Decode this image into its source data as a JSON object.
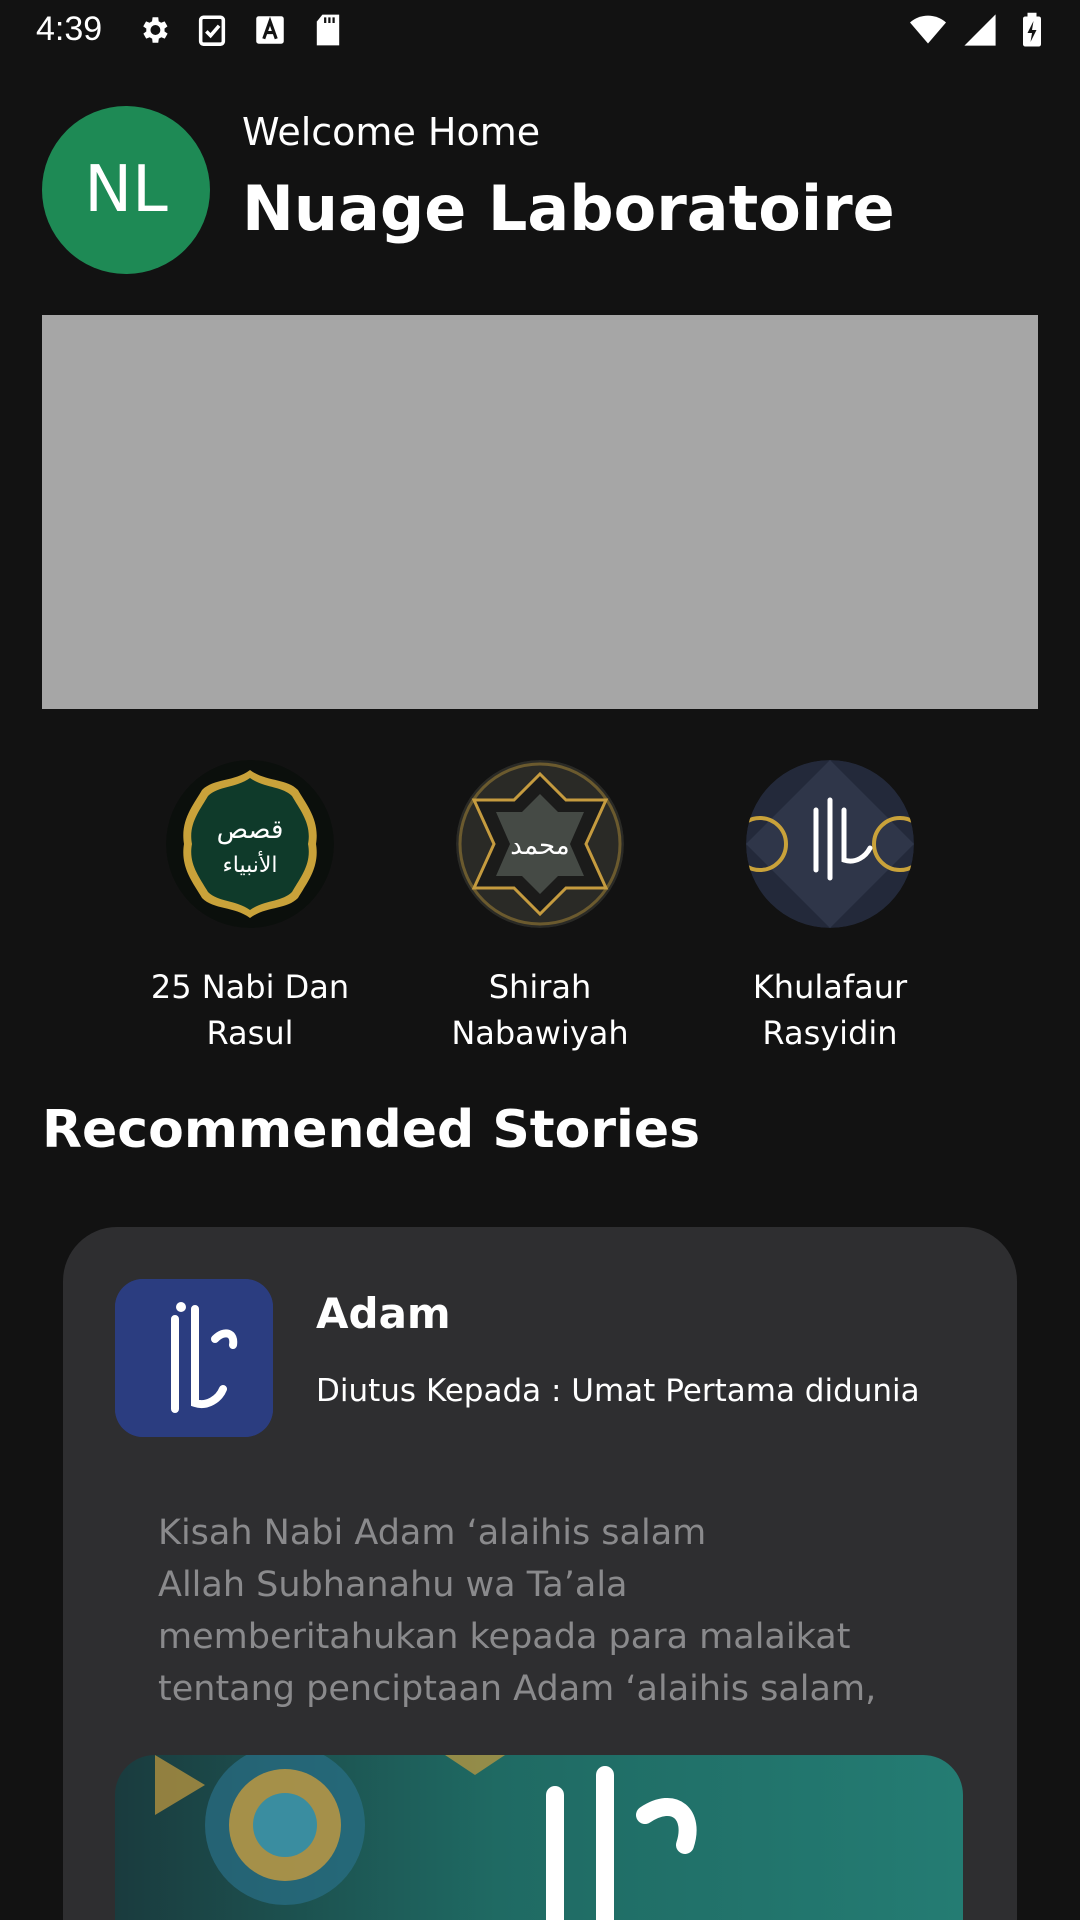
{
  "status_bar": {
    "time": "4:39",
    "left_icons": [
      "gear-icon",
      "clipboard-check-icon",
      "font-a-icon",
      "sd-card-icon"
    ],
    "right_icons": [
      "wifi-icon",
      "signal-icon",
      "battery-charging-icon"
    ]
  },
  "header": {
    "avatar_initials": "NL",
    "avatar_color": "#1e8a55",
    "welcome": "Welcome Home",
    "user_name": "Nuage Laboratoire"
  },
  "categories": [
    {
      "label": "25 Nabi Dan\nRasul",
      "icon": "qasas-al-anbiya-medallion"
    },
    {
      "label": "Shirah\nNabawiyah",
      "icon": "muhammad-rasulullah-medallion"
    },
    {
      "label": "Khulafaur\nRasyidin",
      "icon": "khalifah-calligraphy-medallion"
    }
  ],
  "section": {
    "recommended_title": "Recommended Stories"
  },
  "story": {
    "title": "Adam",
    "subtitle": "Diutus Kepada : Umat Pertama didunia",
    "excerpt": "Kisah Nabi Adam ‘alaihis salam\nAllah Subhanahu wa Ta’ala\nmemberitahukan kepada para malaikat\ntentang penciptaan Adam ‘alaihis salam,",
    "thumb_color": "#2b3d80"
  },
  "colors": {
    "background": "#121212",
    "card": "#2e2e30",
    "banner_placeholder": "#a6a6a6",
    "excerpt_text": "#8a8a8c"
  }
}
